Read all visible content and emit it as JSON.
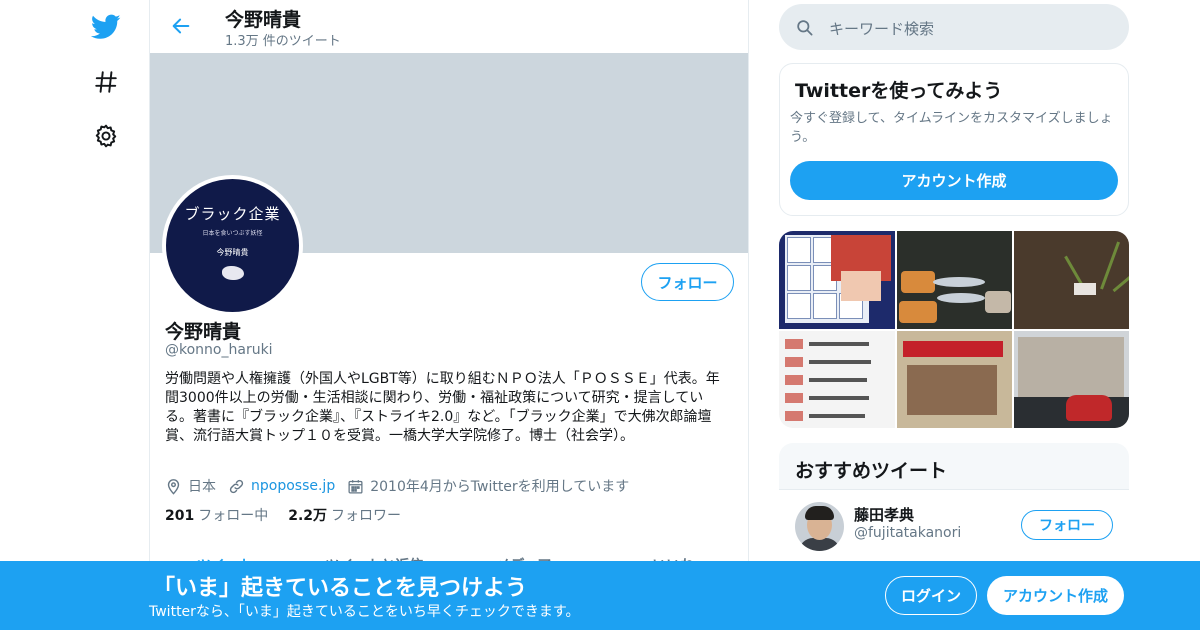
{
  "colors": {
    "accent": "#1da1f2",
    "text_primary": "#14171a",
    "text_secondary": "#657786",
    "banner": "#ccd6dd",
    "border": "#e6ecf0",
    "avatar_background": "#101a49"
  },
  "nav": {
    "icons": [
      "twitter-bird-icon",
      "hashtag-icon",
      "gear-icon"
    ]
  },
  "header": {
    "back_icon": "arrow-left-icon",
    "name": "今野晴貴",
    "tweet_count": "1.3万 件のツイート"
  },
  "profile": {
    "avatar_book_title": "ブラック企業",
    "avatar_book_subtitle": "日本を食いつぶす妖怪",
    "avatar_book_author": "今野晴貴",
    "follow_label": "フォロー",
    "name": "今野晴貴",
    "handle": "@konno_haruki",
    "bio": "労働問題や人権擁護（外国人やLGBT等）に取り組むＮＰＯ法人「ＰＯＳＳＥ」代表。年間3000件以上の労働・生活相談に関わり、労働・福祉政策について研究・提言している。著書に『ブラック企業』、『ストライキ2.0』など。「ブラック企業」で大佛次郎論壇賞、流行語大賞トップ１０を受賞。一橋大学大学院修了。博士（社会学）。",
    "location": "日本",
    "url": "npoposse.jp",
    "joined": "2010年4月からTwitterを利用しています",
    "following_count": "201",
    "following_label": "フォロー中",
    "followers_count": "2.2万",
    "followers_label": "フォロワー"
  },
  "tabs": [
    {
      "label": "ツイート"
    },
    {
      "label": "ツイートと返信"
    },
    {
      "label": "メディア"
    },
    {
      "label": "いいね"
    }
  ],
  "sidebar": {
    "search_placeholder": "キーワード検索",
    "signup_card": {
      "title": "Twitterを使ってみよう",
      "description": "今すぐ登録して、タイムラインをカスタマイズしましょう。",
      "button_label": "アカウント作成"
    },
    "recommended": {
      "title": "おすすめツイート",
      "items": [
        {
          "name": "藤田孝典",
          "handle": "@fujitatakanori",
          "follow_label": "フォロー"
        }
      ]
    }
  },
  "bottom_bar": {
    "title": "「いま」起きていることを見つけよう",
    "subtitle": "Twitterなら、「いま」起きていることをいち早くチェックできます。",
    "login_label": "ログイン",
    "signup_label": "アカウント作成"
  }
}
